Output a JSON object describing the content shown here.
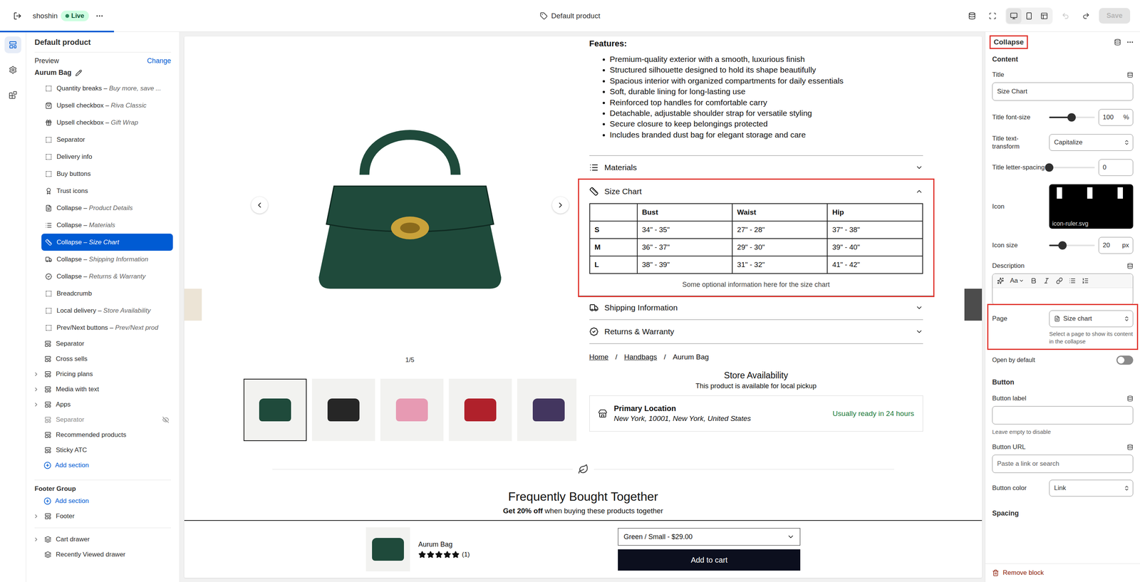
{
  "topbar": {
    "store": "shoshin",
    "status": "Live",
    "template": "Default product",
    "save": "Save",
    "save_disabled": true,
    "loading_level": 0.1,
    "undo_disabled": true,
    "redo_disabled": false,
    "viewports": [
      {
        "selected": true
      },
      {
        "selected": false
      },
      {
        "selected": false
      }
    ]
  },
  "rail": [
    {
      "selected": true
    },
    {
      "selected": false
    },
    {
      "selected": false
    }
  ],
  "sidebar": {
    "title": "Default product",
    "preview_label": "Preview",
    "change": "Change",
    "preview_item": "Aurum Bag",
    "blocks": [
      {
        "label": "Quantity breaks –",
        "sub": "Buy more, save ...",
        "kind": "block",
        "selected": false
      },
      {
        "label": "Upsell checkbox –",
        "sub": "Riva Classic",
        "kind": "bag",
        "selected": false
      },
      {
        "label": "Upsell checkbox –",
        "sub": "Gift Wrap",
        "kind": "gift",
        "selected": false
      },
      {
        "label": "Separator",
        "sub": "",
        "kind": "block",
        "selected": false
      },
      {
        "label": "Delivery info",
        "sub": "",
        "kind": "block",
        "selected": false
      },
      {
        "label": "Buy buttons",
        "sub": "",
        "kind": "block",
        "selected": false
      },
      {
        "label": "Trust icons",
        "sub": "",
        "kind": "trust",
        "selected": false
      },
      {
        "label": "Collapse –",
        "sub": "Product Details",
        "kind": "doc",
        "selected": false
      },
      {
        "label": "Collapse –",
        "sub": "Materials",
        "kind": "list",
        "selected": false
      },
      {
        "label": "Collapse –",
        "sub": "Size Chart",
        "kind": "ruler",
        "selected": true
      },
      {
        "label": "Collapse –",
        "sub": "Shipping Information",
        "kind": "truck",
        "selected": false
      },
      {
        "label": "Collapse –",
        "sub": "Returns & Warranty",
        "kind": "badge",
        "selected": false
      },
      {
        "label": "Breadcrumb",
        "sub": "",
        "kind": "block",
        "selected": false
      },
      {
        "label": "Local delivery –",
        "sub": "Store Availability",
        "kind": "block",
        "selected": false
      },
      {
        "label": "Prev/Next buttons –",
        "sub": "Prev/Next prod",
        "kind": "block",
        "selected": false
      }
    ],
    "sections": [
      {
        "label": "Separator",
        "expandable": false,
        "hidden": false
      },
      {
        "label": "Cross sells",
        "expandable": false,
        "hidden": false
      },
      {
        "label": "Pricing plans",
        "expandable": true,
        "hidden": false
      },
      {
        "label": "Media with text",
        "expandable": true,
        "hidden": false
      },
      {
        "label": "Apps",
        "expandable": true,
        "hidden": false
      },
      {
        "label": "Separator",
        "expandable": false,
        "hidden": true
      },
      {
        "label": "Recommended products",
        "expandable": false,
        "hidden": false
      },
      {
        "label": "Sticky ATC",
        "expandable": false,
        "hidden": false
      }
    ],
    "add_section": "Add section",
    "footer_group": {
      "title": "Footer Group",
      "add_section": "Add section",
      "sections": [
        {
          "label": "Footer",
          "expandable": true
        }
      ]
    },
    "overlays": [
      {
        "label": "Cart drawer",
        "expandable": true
      },
      {
        "label": "Recently Viewed drawer",
        "expandable": false
      }
    ]
  },
  "preview": {
    "peeks": [
      {
        "color": "#e9dfcf"
      },
      {
        "color": "#2d2d2d"
      }
    ],
    "gallery": {
      "counter": "1/5",
      "thumbnails": [
        {
          "color": "#1f4a3b",
          "selected": true
        },
        {
          "color": "#262626",
          "selected": false
        },
        {
          "color": "#e79ab3",
          "selected": false
        },
        {
          "color": "#b0212b",
          "selected": false
        },
        {
          "color": "#43365f",
          "selected": false
        }
      ]
    },
    "features_title": "Features:",
    "features": [
      "Premium-quality exterior with a smooth, luxurious finish",
      "Structured silhouette designed to hold its shape beautifully",
      "Spacious interior with organized compartments for daily essentials",
      "Soft, durable lining for long-lasting use",
      "Reinforced top handles for comfortable carry",
      "Detachable, adjustable shoulder strap for versatile styling",
      "Secure closure to keep belongings protected",
      "Includes branded dust bag for elegant storage and care"
    ],
    "accordions": [
      {
        "title": "Materials",
        "kind": "list",
        "expanded": false,
        "highlighted": false
      },
      {
        "title": "Size Chart",
        "kind": "ruler",
        "expanded": true,
        "highlighted": true
      },
      {
        "title": "Shipping Information",
        "kind": "truck",
        "expanded": false,
        "highlighted": false
      },
      {
        "title": "Returns & Warranty",
        "kind": "badge",
        "expanded": false,
        "highlighted": false
      }
    ],
    "size_chart": {
      "columns": [
        "",
        "Bust",
        "Waist",
        "Hip"
      ],
      "rows": [
        [
          "S",
          "34\" - 35\"",
          "27\" - 28\"",
          "37\" - 38\""
        ],
        [
          "M",
          "36\" - 37\"",
          "29\" - 30\"",
          "39\" - 40\""
        ],
        [
          "L",
          "38\" - 39\"",
          "31\" - 32\"",
          "41\" - 42\""
        ]
      ],
      "note": "Some optional information here for the size chart"
    },
    "breadcrumb": [
      "Home",
      "Handbags",
      "Aurum Bag"
    ],
    "breadcrumb_separator": "/",
    "store": {
      "title": "Store Availability",
      "subtitle": "This product is available for local pickup",
      "location": "Primary Location",
      "address": "New York, 10001, New York, United States",
      "status": "Usually ready in 24 hours"
    },
    "fbt": {
      "title": "Frequently Bought Together",
      "offer": "Get 20% off",
      "offer_rest": " when buying these products together"
    },
    "sticky": {
      "name": "Aurum Bag",
      "stars": 5,
      "count": "(1)",
      "variant": "Green / Small - $29.00",
      "button": "Add to cart"
    }
  },
  "inspector": {
    "title": "Collapse",
    "highlighted": true,
    "section": "Content",
    "title_field": {
      "label": "Title",
      "value": "Size Chart"
    },
    "font_size": {
      "label": "Title font-size",
      "level": 0.49,
      "value": "100",
      "unit": "%"
    },
    "text_transform": {
      "label": "Title text-transform",
      "value": "Capitalize"
    },
    "letter_spacing": {
      "label": "Title letter-spacing",
      "level": 0,
      "value": "0"
    },
    "icon": {
      "label": "Icon",
      "file": "icon-ruler.svg"
    },
    "icon_size": {
      "label": "Icon size",
      "level": 0.29,
      "value": "20",
      "unit": "px"
    },
    "description": {
      "label": "Description",
      "format": "Aa"
    },
    "page": {
      "label": "Page",
      "value": "Size chart",
      "help": "Select a page to show its content in the collapse",
      "highlighted": true
    },
    "open_default": {
      "label": "Open by default",
      "on": false
    },
    "button_section": "Button",
    "button_label": {
      "label": "Button label",
      "value": "",
      "help": "Leave empty to disable"
    },
    "button_url": {
      "label": "Button URL",
      "placeholder": "Paste a link or search"
    },
    "button_color": {
      "label": "Button color",
      "value": "Link"
    },
    "spacing": "Spacing",
    "remove": "Remove block"
  }
}
